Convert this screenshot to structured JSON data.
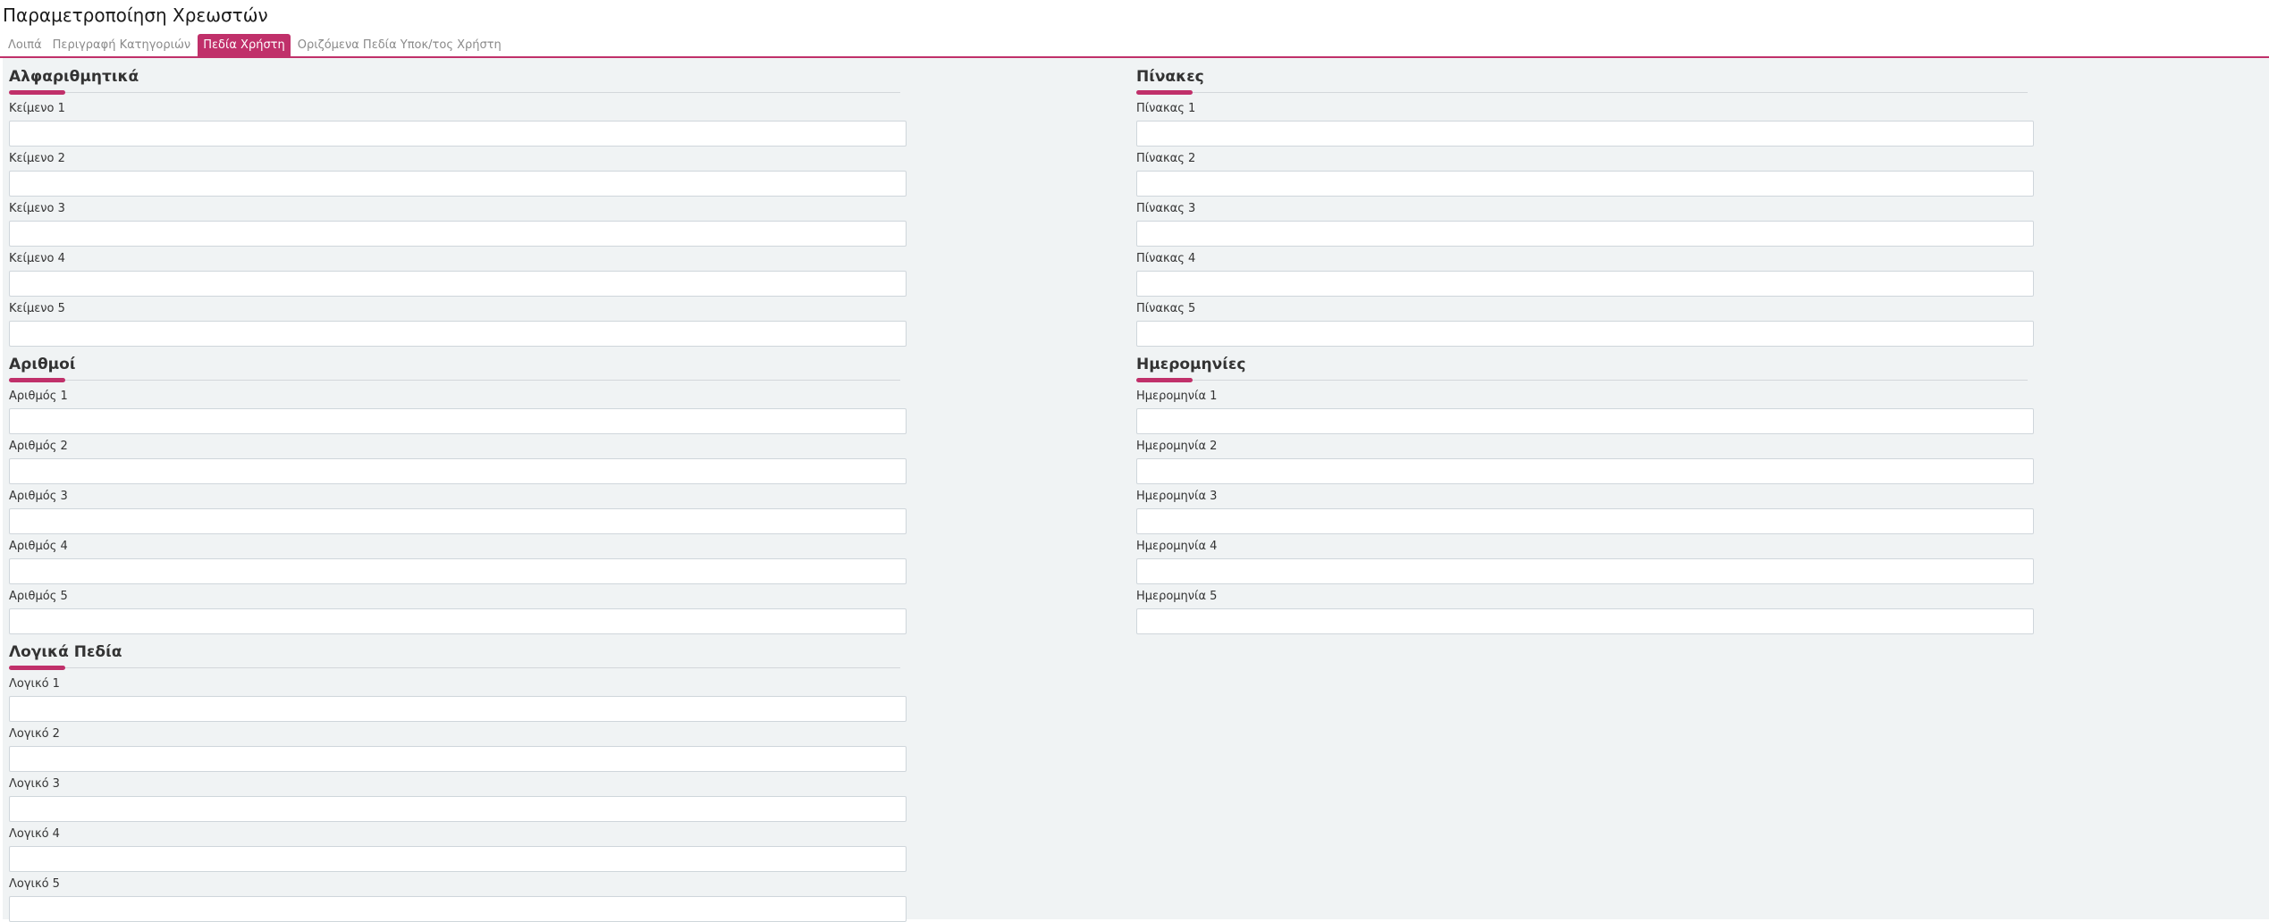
{
  "page": {
    "title": "Παραμετροποίηση Χρεωστών"
  },
  "tabs": [
    {
      "label": "Λοιπά",
      "active": false
    },
    {
      "label": "Περιγραφή Κατηγοριών",
      "active": false
    },
    {
      "label": "Πεδία Χρήστη",
      "active": true
    },
    {
      "label": "Οριζόμενα Πεδία Υποκ/τος Χρήστη",
      "active": false
    }
  ],
  "sections": {
    "alphanumeric": {
      "title": "Αλφαριθμητικά",
      "fields": [
        {
          "label": "Κείμενο 1",
          "value": ""
        },
        {
          "label": "Κείμενο 2",
          "value": ""
        },
        {
          "label": "Κείμενο 3",
          "value": ""
        },
        {
          "label": "Κείμενο 4",
          "value": ""
        },
        {
          "label": "Κείμενο 5",
          "value": ""
        }
      ]
    },
    "tables": {
      "title": "Πίνακες",
      "fields": [
        {
          "label": "Πίνακας 1",
          "value": ""
        },
        {
          "label": "Πίνακας 2",
          "value": ""
        },
        {
          "label": "Πίνακας 3",
          "value": ""
        },
        {
          "label": "Πίνακας 4",
          "value": ""
        },
        {
          "label": "Πίνακας 5",
          "value": ""
        }
      ]
    },
    "numbers": {
      "title": "Αριθμοί",
      "fields": [
        {
          "label": "Αριθμός 1",
          "value": ""
        },
        {
          "label": "Αριθμός 2",
          "value": ""
        },
        {
          "label": "Αριθμός 3",
          "value": ""
        },
        {
          "label": "Αριθμός 4",
          "value": ""
        },
        {
          "label": "Αριθμός 5",
          "value": ""
        }
      ]
    },
    "dates": {
      "title": "Ημερομηνίες",
      "fields": [
        {
          "label": "Ημερομηνία 1",
          "value": ""
        },
        {
          "label": "Ημερομηνία 2",
          "value": ""
        },
        {
          "label": "Ημερομηνία 3",
          "value": ""
        },
        {
          "label": "Ημερομηνία 4",
          "value": ""
        },
        {
          "label": "Ημερομηνία 5",
          "value": ""
        }
      ]
    },
    "logical": {
      "title": "Λογικά Πεδία",
      "fields": [
        {
          "label": "Λογικό 1",
          "value": ""
        },
        {
          "label": "Λογικό 2",
          "value": ""
        },
        {
          "label": "Λογικό 3",
          "value": ""
        },
        {
          "label": "Λογικό 4",
          "value": ""
        },
        {
          "label": "Λογικό 5",
          "value": ""
        }
      ]
    }
  },
  "colors": {
    "accent": "#c0306a",
    "content_bg": "#f0f3f4",
    "input_border": "#cfd6db"
  }
}
